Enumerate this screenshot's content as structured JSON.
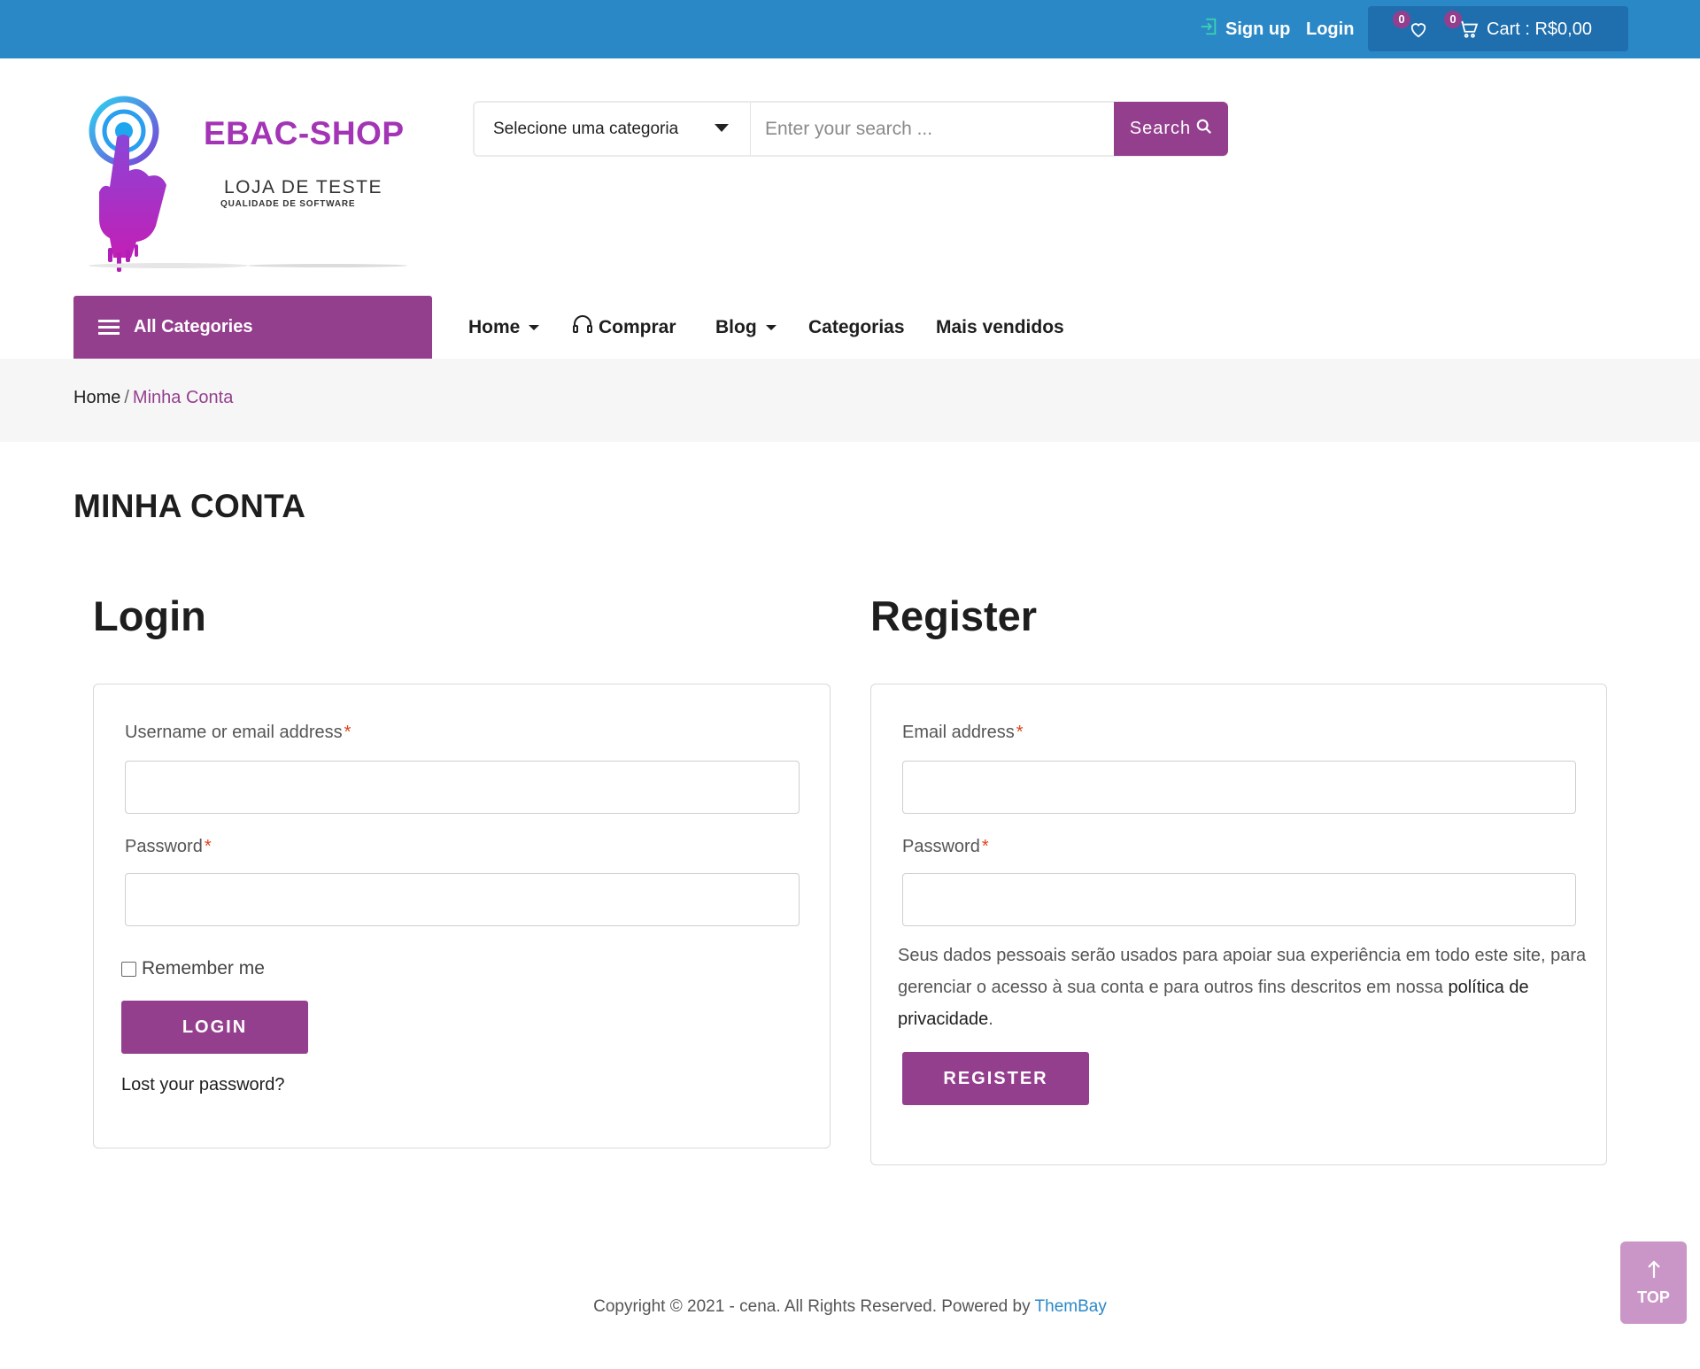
{
  "topbar": {
    "signup_label": "Sign up",
    "login_label": "Login",
    "wishlist_count": "0",
    "cart_count": "0",
    "cart_label": "Cart : R$0,00"
  },
  "logo": {
    "title": "EBAC-SHOP",
    "subtitle": "LOJA DE TESTE",
    "tagline": "QUALIDADE DE SOFTWARE"
  },
  "search": {
    "category_selected": "Selecione uma categoria",
    "placeholder": "Enter your search ...",
    "button_label": "Search"
  },
  "nav": {
    "all_categories": "All Categories",
    "items": [
      {
        "label": "Home"
      },
      {
        "label": "Comprar"
      },
      {
        "label": "Blog"
      },
      {
        "label": "Categorias"
      },
      {
        "label": "Mais vendidos"
      }
    ]
  },
  "breadcrumb": {
    "home": "Home",
    "separator": "/",
    "current": "Minha Conta"
  },
  "page": {
    "title": "MINHA CONTA"
  },
  "login": {
    "heading": "Login",
    "username_label": "Username or email address",
    "password_label": "Password",
    "required_mark": "*",
    "remember_label": "Remember me",
    "button_label": "LOGIN",
    "lost_password": "Lost your password?"
  },
  "register": {
    "heading": "Register",
    "email_label": "Email address",
    "password_label": "Password",
    "required_mark": "*",
    "privacy_text": "Seus dados pessoais serão usados para apoiar sua experiência em todo este site, para gerenciar o acesso à sua conta e para outros fins descritos em nossa ",
    "privacy_link": "política de privacidade",
    "privacy_end": ".",
    "button_label": "REGISTER"
  },
  "footer": {
    "copyright": "Copyright © 2021 - cena. All Rights Reserved. Powered by ",
    "powered_link": "ThemBay",
    "top_label": "TOP"
  },
  "colors": {
    "topbar": "#2b88c6",
    "cartbox": "#1f6ead",
    "brand_purple": "#943f8e",
    "breadcrumb_bg": "#f6f6f6",
    "top_button": "#c996c7"
  }
}
